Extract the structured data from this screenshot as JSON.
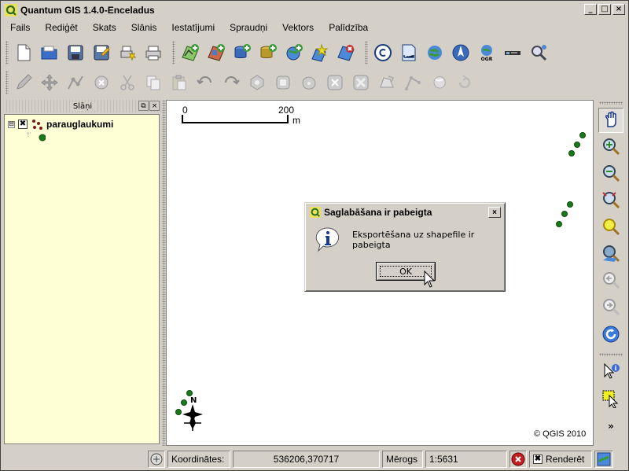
{
  "window": {
    "title": "Quantum GIS 1.4.0-Enceladus",
    "minimize_glyph": "_",
    "maximize_glyph": "□",
    "close_glyph": "×"
  },
  "menu": {
    "items": [
      "Fails",
      "Rediģēt",
      "Skats",
      "Slānis",
      "Iestatījumi",
      "Spraudņi",
      "Vektors",
      "Palīdzība"
    ]
  },
  "toolbar_file": {
    "icons": [
      "new-project-icon",
      "open-project-icon",
      "save-project-icon",
      "save-as-icon",
      "print-composer-icon",
      "print-icon"
    ]
  },
  "toolbar_layers": {
    "icons": [
      "add-vector-layer-icon",
      "add-raster-layer-icon",
      "add-postgis-layer-icon",
      "add-spatialite-layer-icon",
      "add-wms-layer-icon",
      "new-vector-layer-icon",
      "remove-layer-icon"
    ]
  },
  "toolbar_plugins": {
    "icons": [
      "copyright-label-icon",
      "scale-bar-icon",
      "georeferencer-icon",
      "north-arrow-icon",
      "ogr-converter-icon",
      "gps-tools-icon",
      "identify-plugin-icon"
    ]
  },
  "toolbar_digitize": {
    "icons": [
      "toggle-editing-icon",
      "move-feature-icon",
      "node-tool-icon",
      "delete-selected-icon",
      "cut-features-icon",
      "copy-features-icon",
      "paste-features-icon",
      "undo-icon",
      "redo-icon",
      "add-ring-icon",
      "add-island-icon",
      "simplify-feature-icon",
      "delete-ring-icon",
      "delete-part-icon",
      "reshape-features-icon",
      "split-features-icon",
      "merge-features-icon",
      "rotate-label-icon"
    ]
  },
  "legend": {
    "title": "Slāņi",
    "float_glyph": "⧉",
    "close_glyph": "×",
    "layer": {
      "name": "parauglaukumi",
      "expander": "⊟",
      "checked_glyph": "✖"
    }
  },
  "map": {
    "scalebar": {
      "left_label": "0",
      "right_label": "200",
      "unit": "m"
    },
    "north_label": "N",
    "copyright": "© QGIS 2010",
    "point_color": "#1a7a1a"
  },
  "right_toolbar": {
    "icons": [
      "pan-icon",
      "zoom-in-icon",
      "zoom-out-icon",
      "zoom-full-icon",
      "zoom-to-selection-icon",
      "zoom-to-layer-icon",
      "zoom-last-icon",
      "zoom-next-icon",
      "refresh-icon",
      "identify-icon",
      "select-features-icon"
    ],
    "more_glyph": "»"
  },
  "status": {
    "coord_label": "Koordinātes:",
    "coord_value": "536206,370717",
    "scale_label": "Mērogs",
    "scale_value": "1:5631",
    "render_label": "Renderēt",
    "render_checked_glyph": "✖"
  },
  "dialog": {
    "title": "Saglabāšana ir pabeigta",
    "message": "Eksportēšana uz shapefile ir pabeigta",
    "ok_label": "OK",
    "close_glyph": "×"
  }
}
